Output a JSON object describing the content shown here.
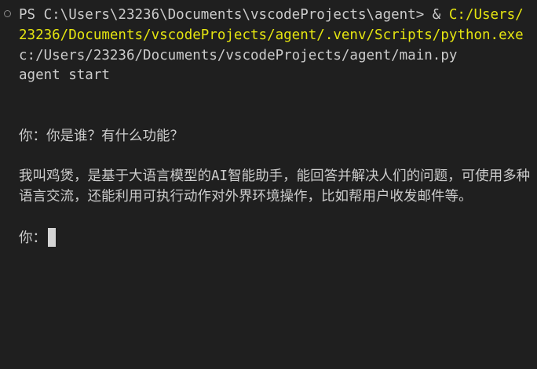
{
  "terminal": {
    "prompt": "PS C:\\Users\\23236\\Documents\\vscodeProjects\\agent> ",
    "operator": "& ",
    "python_path": "C:/Users/23236/Documents/vscodeProjects/agent/.venv/Scripts/python.exe",
    "script_arg": " c:/Users/23236/Documents/vscodeProjects/agent/main.py",
    "output_start": "agent start",
    "user_prefix": "你：",
    "user_question": "你是谁？有什么功能？",
    "agent_response": "我叫鸡煲，是基于大语言模型的AI智能助手，能回答并解决人们的问题，可使用多种语言交流，还能利用可执行动作对外界环境操作，比如帮用户收发邮件等。",
    "input_prompt": "你："
  }
}
